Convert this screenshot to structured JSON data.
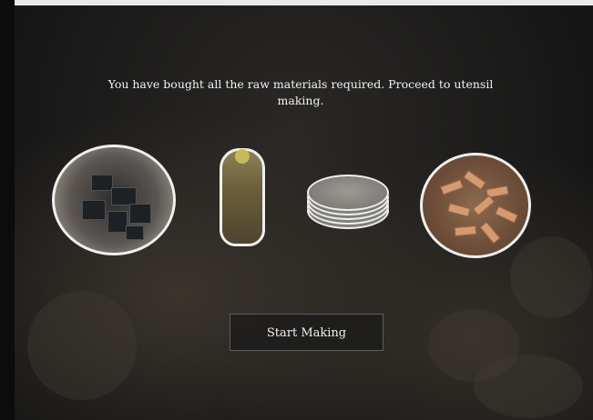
{
  "message": "You have bought all the raw materials required. Proceed to utensil making.",
  "materials": [
    {
      "icon": "coal-bowl-icon"
    },
    {
      "icon": "oil-bottle-icon"
    },
    {
      "icon": "metal-plates-icon"
    },
    {
      "icon": "bricks-icon"
    }
  ],
  "start_button_label": "Start Making",
  "colors": {
    "text": "#f2f2f2",
    "outline": "#efefef",
    "button_border": "#5e5e5e"
  }
}
